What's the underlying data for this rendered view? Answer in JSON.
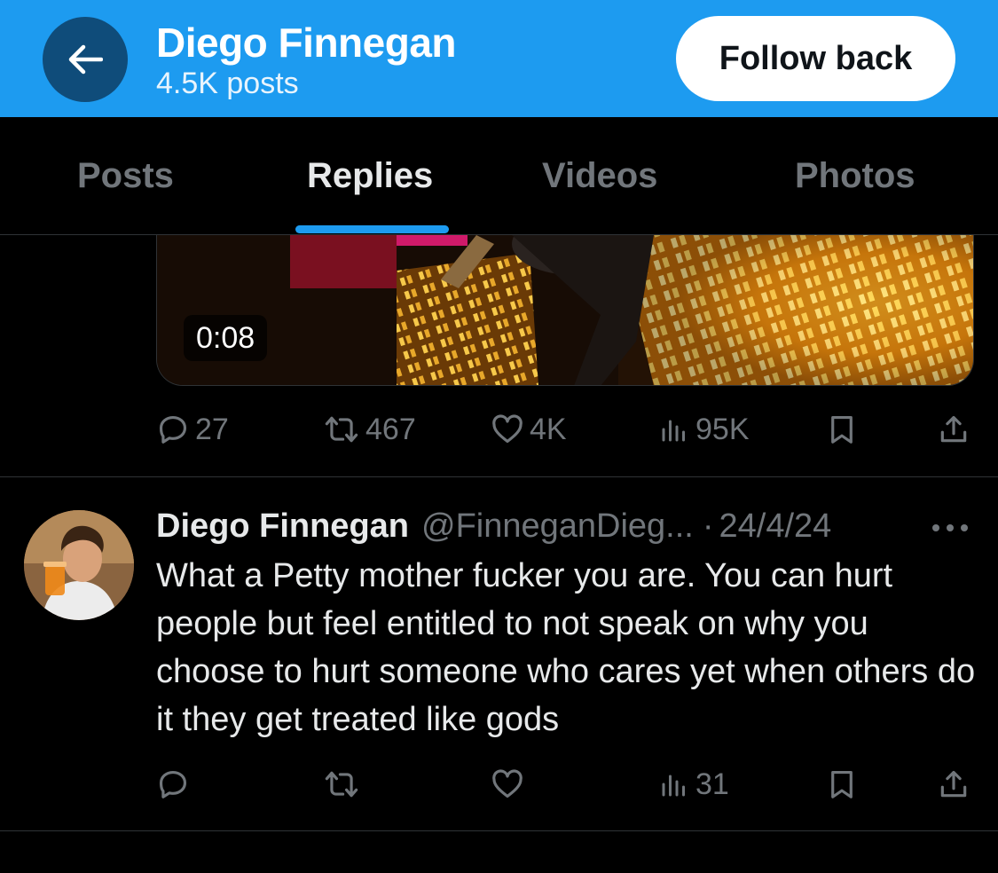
{
  "header": {
    "title": "Diego Finnegan",
    "subtitle": "4.5K posts",
    "follow_label": "Follow back"
  },
  "tabs": [
    {
      "label": "Posts",
      "active": false
    },
    {
      "label": "Replies",
      "active": true
    },
    {
      "label": "Videos",
      "active": false
    },
    {
      "label": "Photos",
      "active": false
    }
  ],
  "video": {
    "duration": "0:08"
  },
  "post1_actions": {
    "replies": "27",
    "reposts": "467",
    "likes": "4K",
    "views": "95K"
  },
  "tweet": {
    "name": "Diego Finnegan",
    "handle": "@FinneganDieg...",
    "separator": "·",
    "date": "24/4/24",
    "text": "What a Petty mother fucker you are. You can hurt people but feel entitled to not speak on why you choose to hurt someone who cares yet when others do it they get treated like gods",
    "actions": {
      "replies": "",
      "reposts": "",
      "likes": "",
      "views": "31"
    }
  },
  "colors": {
    "accent": "#1d9bf0",
    "back_button": "#0f4c7a",
    "background": "#000000",
    "muted_text": "#71767b",
    "primary_text": "#e7e9ea"
  }
}
